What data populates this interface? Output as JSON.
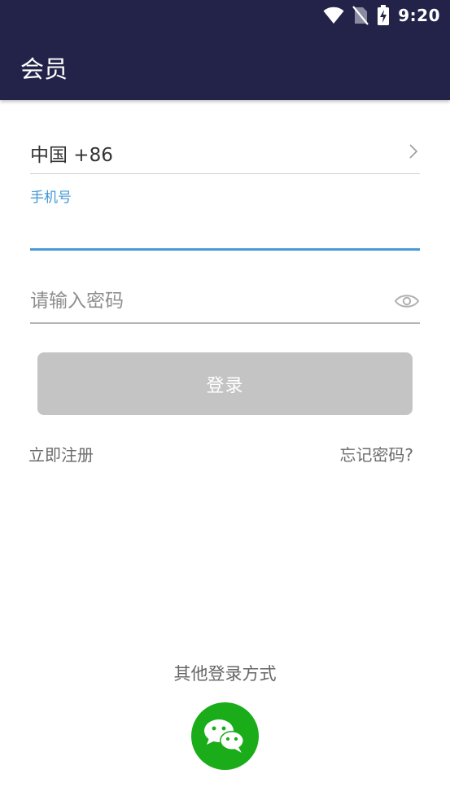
{
  "status_bar": {
    "time": "9:20",
    "icons": [
      "wifi-icon",
      "no-sim-icon",
      "battery-charging-icon"
    ]
  },
  "app_bar": {
    "title": "会员",
    "background_color": "#23234a"
  },
  "form": {
    "country": {
      "label": "中国 +86",
      "icon": "chevron-right-icon"
    },
    "phone": {
      "label": "手机号",
      "value": "",
      "accent_color": "#3f97d6"
    },
    "password": {
      "placeholder": "请输入密码",
      "value": "",
      "icon": "eye-icon"
    },
    "login_button": {
      "label": "登录",
      "background_color": "#c4c4c4",
      "state": "disabled"
    },
    "register_link": "立即注册",
    "forgot_link": "忘记密码?"
  },
  "other_login": {
    "label": "其他登录方式",
    "wechat": {
      "icon": "wechat-icon",
      "color": "#1aad19"
    }
  }
}
